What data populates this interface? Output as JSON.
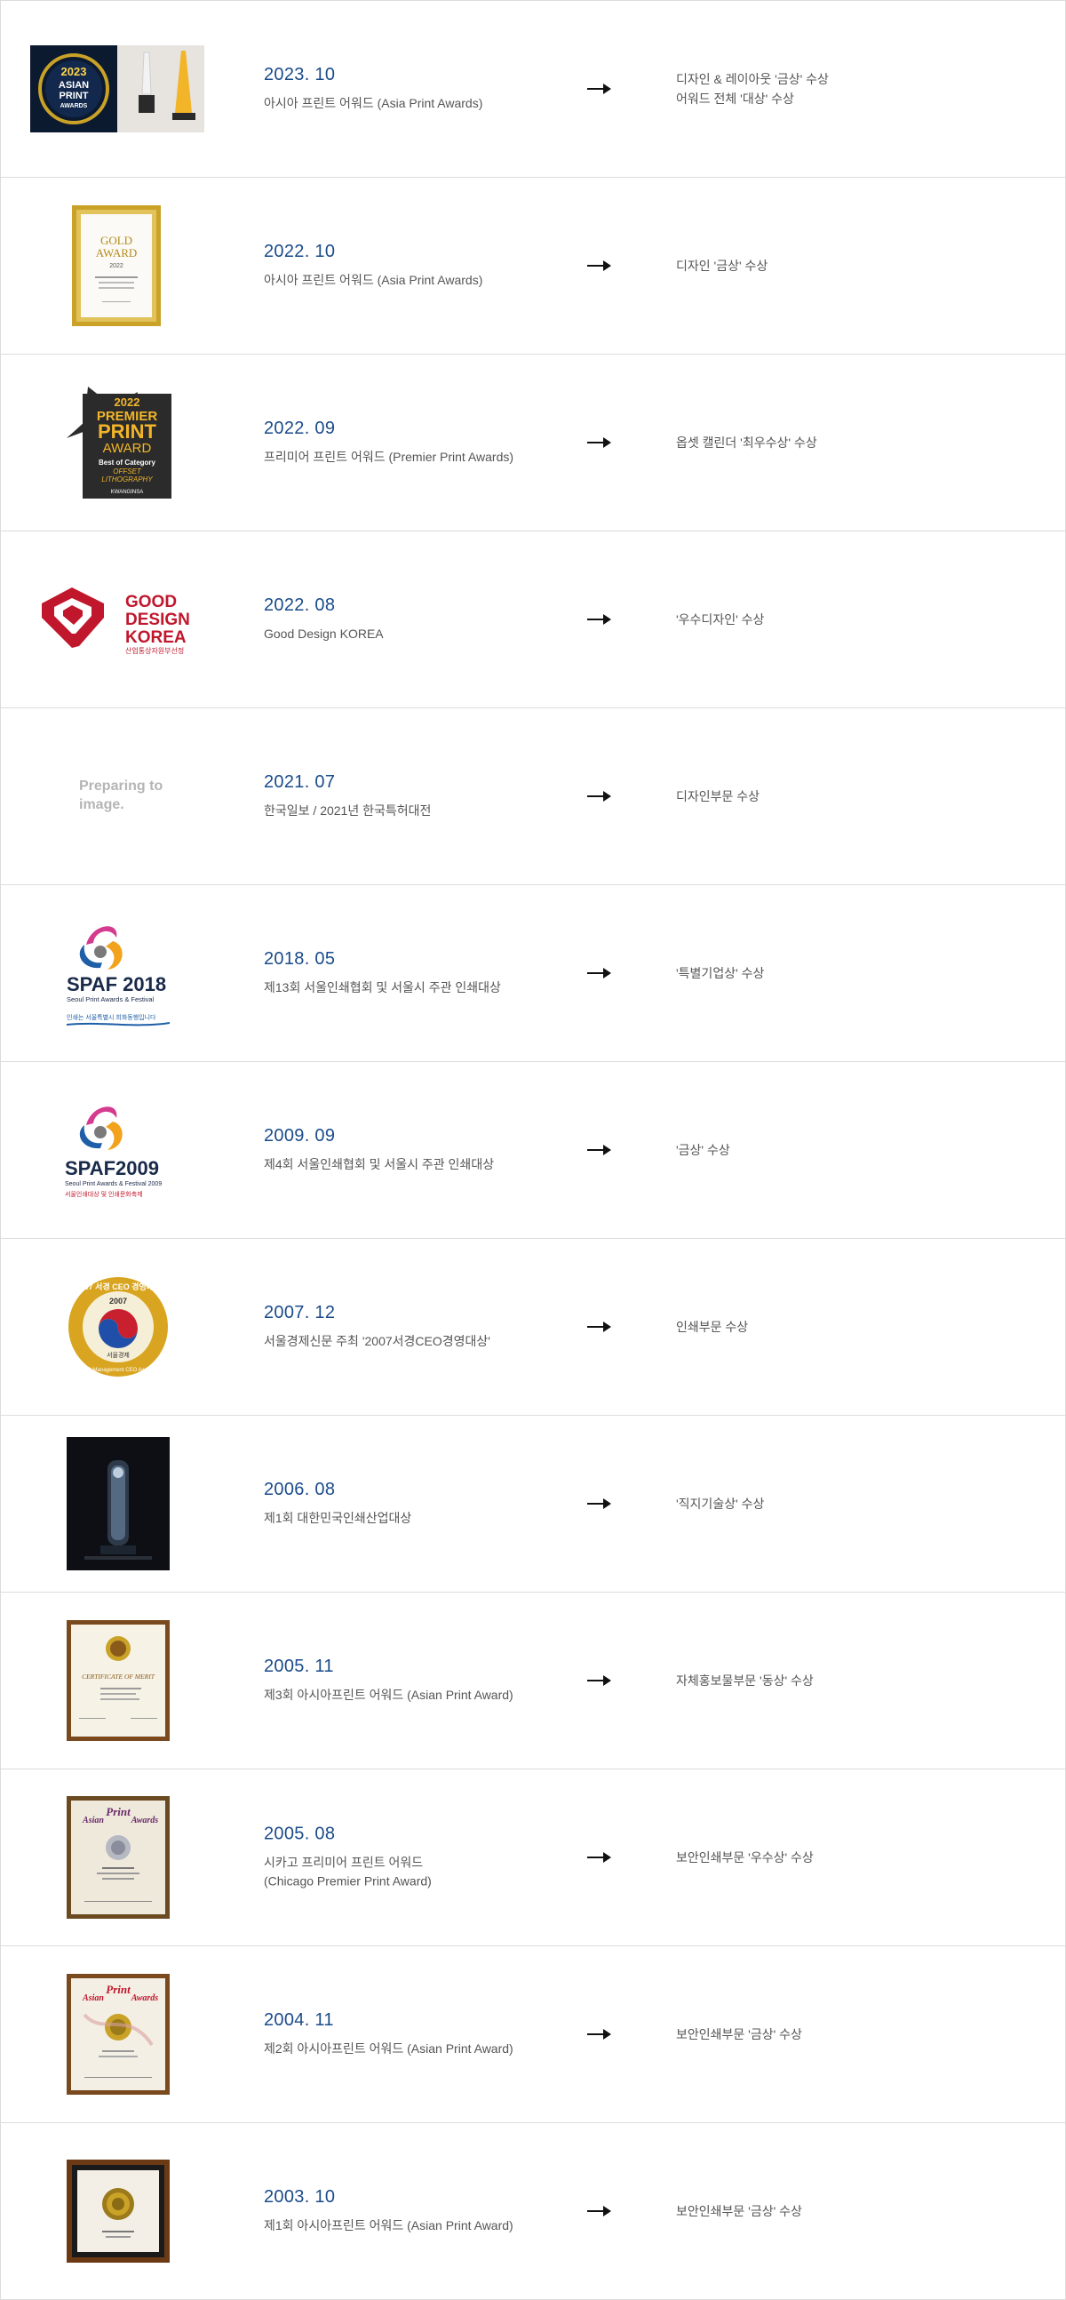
{
  "awards": [
    {
      "date": "2023. 10",
      "desc": "아시아 프린트 어워드 (Asia Print Awards)",
      "result": "디자인 & 레이아웃 '금상' 수상\n어워드 전체 '대상' 수상",
      "badge": {
        "year": "2023",
        "l1": "ASIAN",
        "l2": "PRINT",
        "l3": "AWARDS"
      }
    },
    {
      "date": "2022. 10",
      "desc": "아시아 프린트 어워드 (Asia Print Awards)",
      "result": "디자인 '금상' 수상",
      "badge": {
        "l1": "GOLD",
        "l2": "AWARD",
        "l3": "2022"
      }
    },
    {
      "date": "2022. 09",
      "desc": "프리미어 프린트 어워드 (Premier Print Awards)",
      "result": "옵셋 캘린더 '최우수상' 수상",
      "badge": {
        "l1": "2022",
        "l2": "PREMIER",
        "l3": "PRINT",
        "l4": "AWARD",
        "l5": "Best of Category",
        "l6": "OFFSET",
        "l7": "LITHOGRAPHY",
        "l8": "KWANGINSA"
      }
    },
    {
      "date": "2022. 08",
      "desc": "Good Design KOREA",
      "result": "'우수디자인' 수상",
      "badge": {
        "l1": "GOOD",
        "l2": "DESIGN",
        "l3": "KOREA",
        "l4": "산업통상자원부선정"
      }
    },
    {
      "date": "2021. 07",
      "desc": "한국일보 / 2021년 한국특허대전",
      "result": "디자인부문 수상",
      "badge": {
        "placeholder": "Preparing to\nimage."
      }
    },
    {
      "date": "2018. 05",
      "desc": "제13회 서울인쇄협회 및 서울시 주관 인쇄대상",
      "result": "'특별기업상' 수상",
      "badge": {
        "l1": "SPAF 2018",
        "l2": "Seoul Print Awards & Festival",
        "l3": "인쇄는 서울특별시 희화동행입니다"
      }
    },
    {
      "date": "2009. 09",
      "desc": "제4회 서울인쇄협회 및 서울시 주관 인쇄대상",
      "result": "'금상' 수상",
      "badge": {
        "l1": "SPAF2009",
        "l2": "Seoul Print Awards & Festival 2009",
        "l3": "서울인쇄대상 및 인쇄문화축제"
      }
    },
    {
      "date": "2007. 12",
      "desc": "서울경제신문 주최 '2007서경CEO경영대상'",
      "result": "인쇄부문 수상",
      "badge": {
        "l1": "2007 서경 CEO 경영대상",
        "l2": "2007",
        "l3": "서울경제",
        "l4": "SEN Management CEO Awards"
      }
    },
    {
      "date": "2006. 08",
      "desc": "제1회 대한민국인쇄산업대상",
      "result": "'직지기술상' 수상",
      "badge": {}
    },
    {
      "date": "2005. 11",
      "desc": "제3회 아시아프린트 어워드 (Asian Print Award)",
      "result": "자체홍보물부문 '동상' 수상",
      "badge": {
        "l1": "CERTIFICATE OF MERIT"
      }
    },
    {
      "date": "2005. 08",
      "desc": "시카고 프리미어 프린트 어워드\n(Chicago Premier Print Award)",
      "result": "보안인쇄부문 '우수상' 수상",
      "badge": {
        "l1": "Asian",
        "l2": "Print",
        "l3": "Awards"
      }
    },
    {
      "date": "2004. 11",
      "desc": "제2회 아시아프린트 어워드 (Asian Print Award)",
      "result": "보안인쇄부문 '금상' 수상",
      "badge": {
        "l1": "Asian",
        "l2": "Print",
        "l3": "Awards"
      }
    },
    {
      "date": "2003. 10",
      "desc": "제1회 아시아프린트 어워드 (Asian Print Award)",
      "result": "보안인쇄부문 '금상' 수상",
      "badge": {}
    }
  ],
  "colors": {
    "date": "#1a4b8a",
    "text": "#555555",
    "border": "#dcdcdc",
    "gold": "#c9a227",
    "gdk_red": "#c0172c"
  }
}
